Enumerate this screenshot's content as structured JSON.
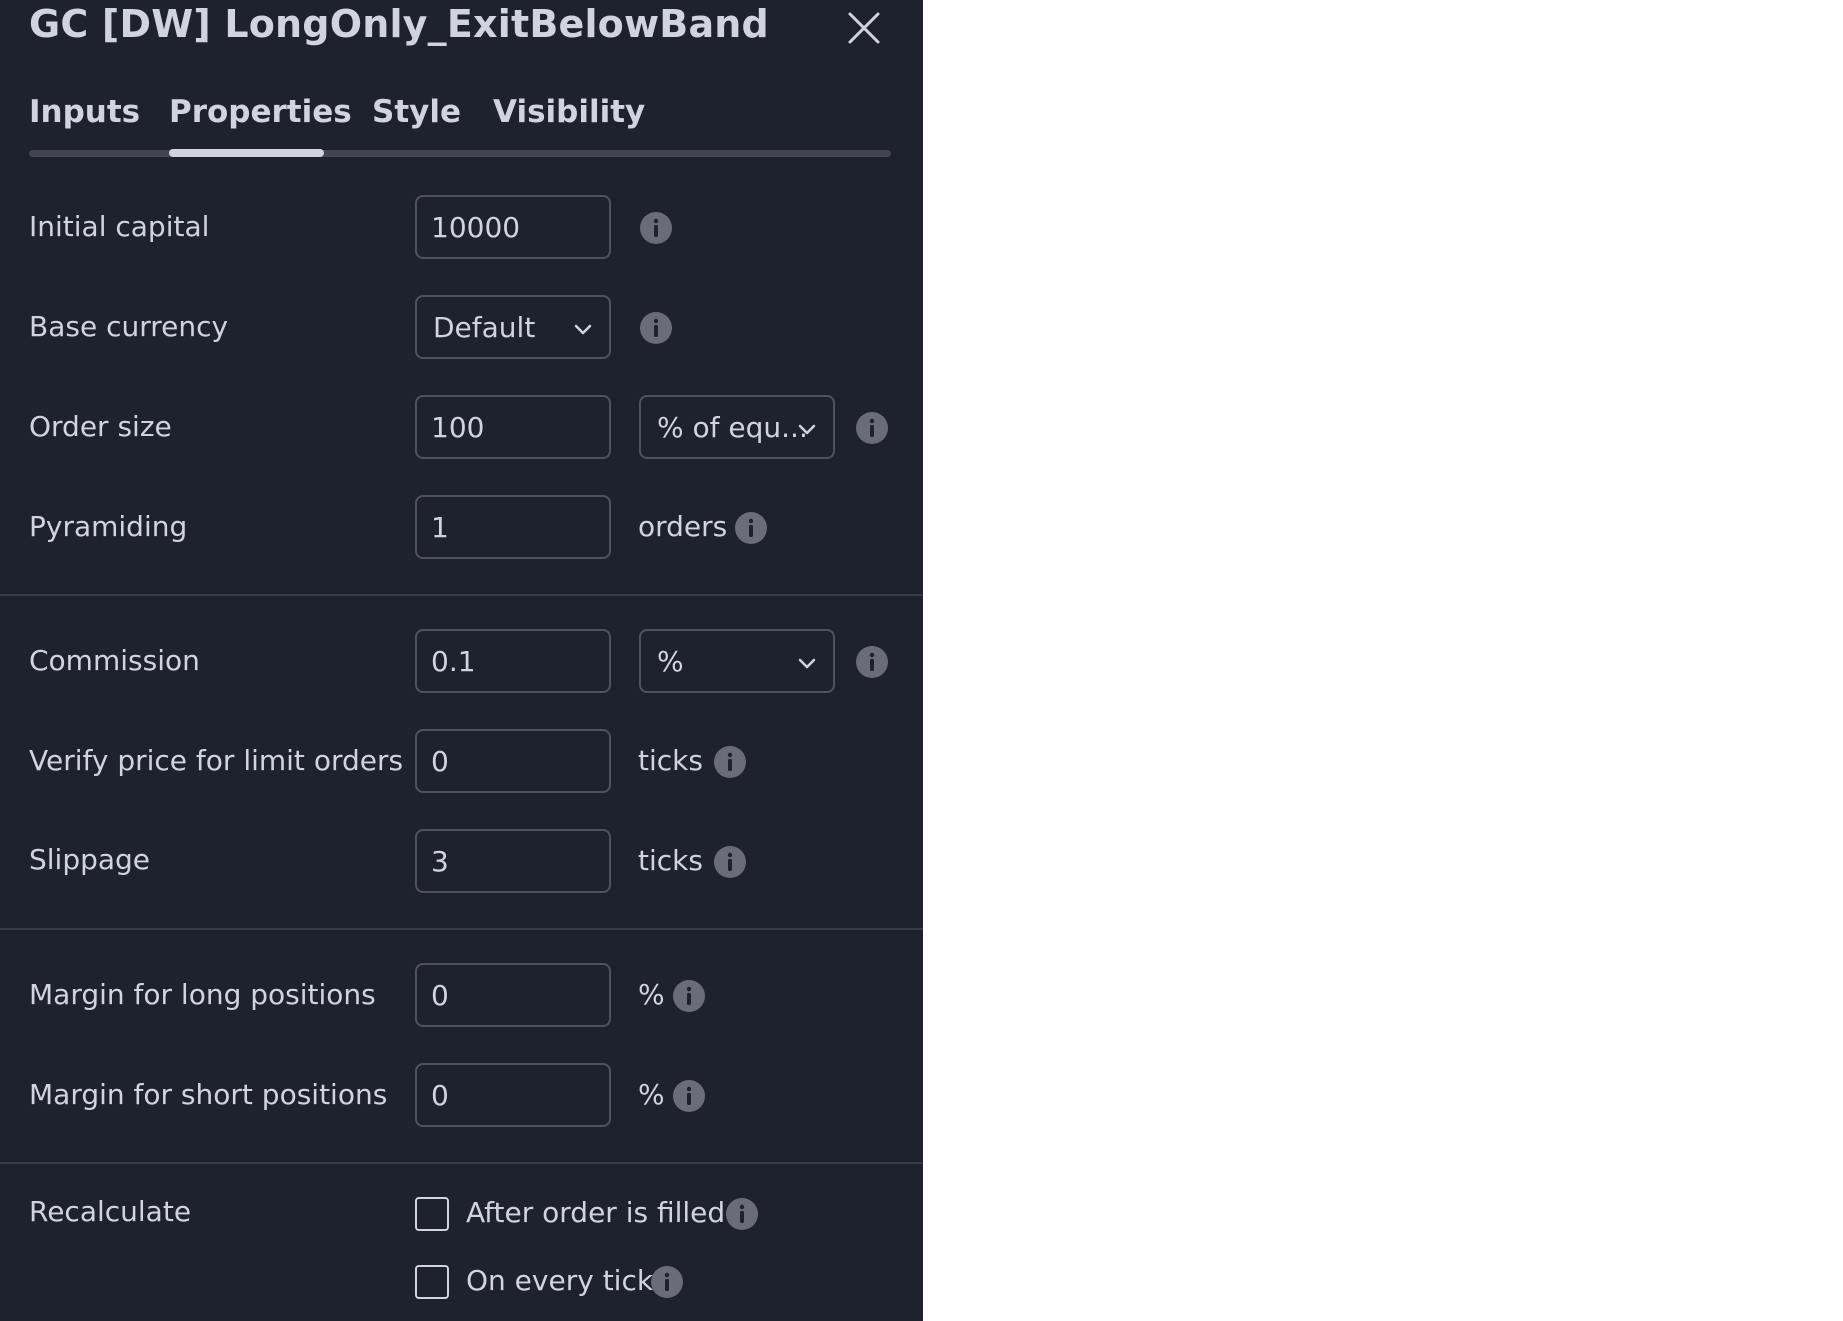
{
  "dialog": {
    "title": "GC [DW] LongOnly_ExitBelowBand"
  },
  "tabs": [
    {
      "label": "Inputs",
      "active": false
    },
    {
      "label": "Properties",
      "active": true
    },
    {
      "label": "Style",
      "active": false
    },
    {
      "label": "Visibility",
      "active": false
    }
  ],
  "properties": {
    "initial_capital": {
      "label": "Initial capital",
      "value": "10000"
    },
    "base_currency": {
      "label": "Base currency",
      "value": "Default"
    },
    "order_size": {
      "label": "Order size",
      "value": "100",
      "unit": "% of equ..."
    },
    "pyramiding": {
      "label": "Pyramiding",
      "value": "1",
      "unit": "orders"
    },
    "commission": {
      "label": "Commission",
      "value": "0.1",
      "unit": "%"
    },
    "verify_price": {
      "label": "Verify price for limit orders",
      "value": "0",
      "unit": "ticks"
    },
    "slippage": {
      "label": "Slippage",
      "value": "3",
      "unit": "ticks"
    },
    "margin_long": {
      "label": "Margin for long positions",
      "value": "0",
      "unit": "%"
    },
    "margin_short": {
      "label": "Margin for short positions",
      "value": "0",
      "unit": "%"
    },
    "recalculate": {
      "label": "Recalculate",
      "options": [
        {
          "label": "After order is filled",
          "checked": false
        },
        {
          "label": "On every tick",
          "checked": false
        }
      ]
    }
  },
  "colors": {
    "panel_bg": "#1e222d",
    "text": "#d1d4dc",
    "border": "#50535e",
    "divider": "#363a45",
    "info_icon": "#6a6d78"
  }
}
